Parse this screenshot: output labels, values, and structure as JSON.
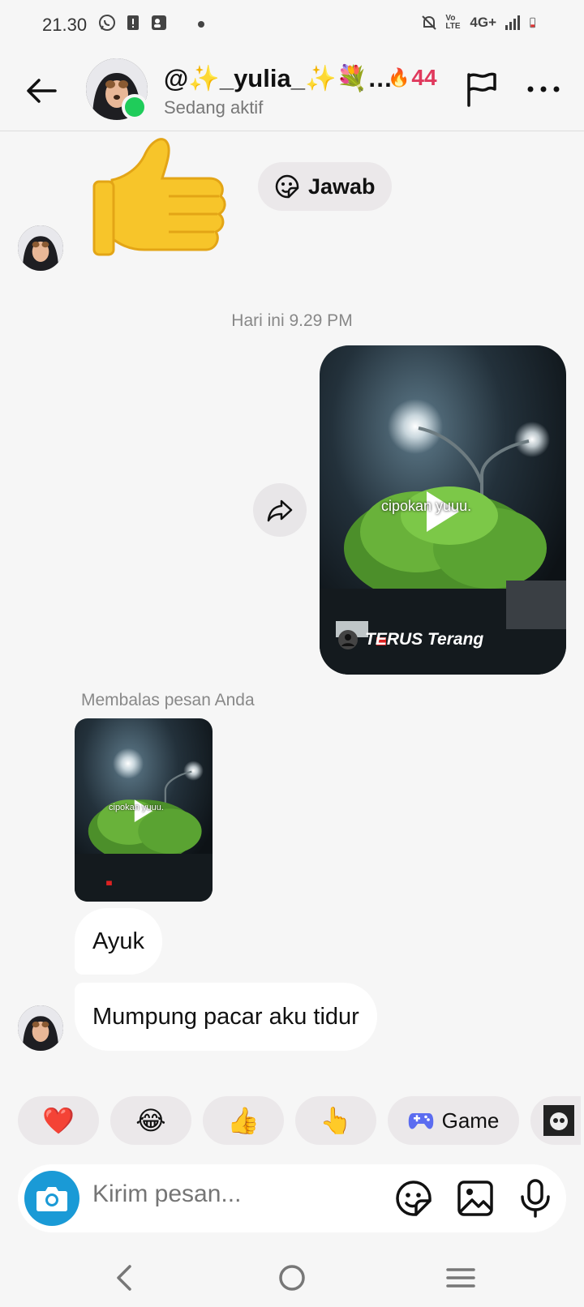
{
  "status_bar": {
    "time": "21.30",
    "network": "4G+",
    "volte": "Vo LTE"
  },
  "header": {
    "username": "@✨_yulia_✨💐…",
    "streak_count": "44",
    "streak_icon": "🔥",
    "status": "Sedang aktif"
  },
  "messages": {
    "thumbs_emoji": "👍",
    "reply_chip_label": "Jawab",
    "timestamp": "Hari ini 9.29 PM",
    "video_overlay_text": "cipokan yuuu.",
    "video_account": "TERUS Terang",
    "reply_label": "Membalas pesan Anda",
    "bubble_1": "Ayuk",
    "bubble_2": "Mumpung pacar aku tidur"
  },
  "quick_reactions": {
    "heart": "❤️",
    "laugh": "😂",
    "thumbs": "👍",
    "point": "👆",
    "game_label": "Game"
  },
  "composer": {
    "placeholder": "Kirim pesan..."
  },
  "colors": {
    "online": "#1fcc5a",
    "streak": "#e0395d",
    "camera": "#1a9ad6",
    "game_icon": "#5b6cf0"
  }
}
